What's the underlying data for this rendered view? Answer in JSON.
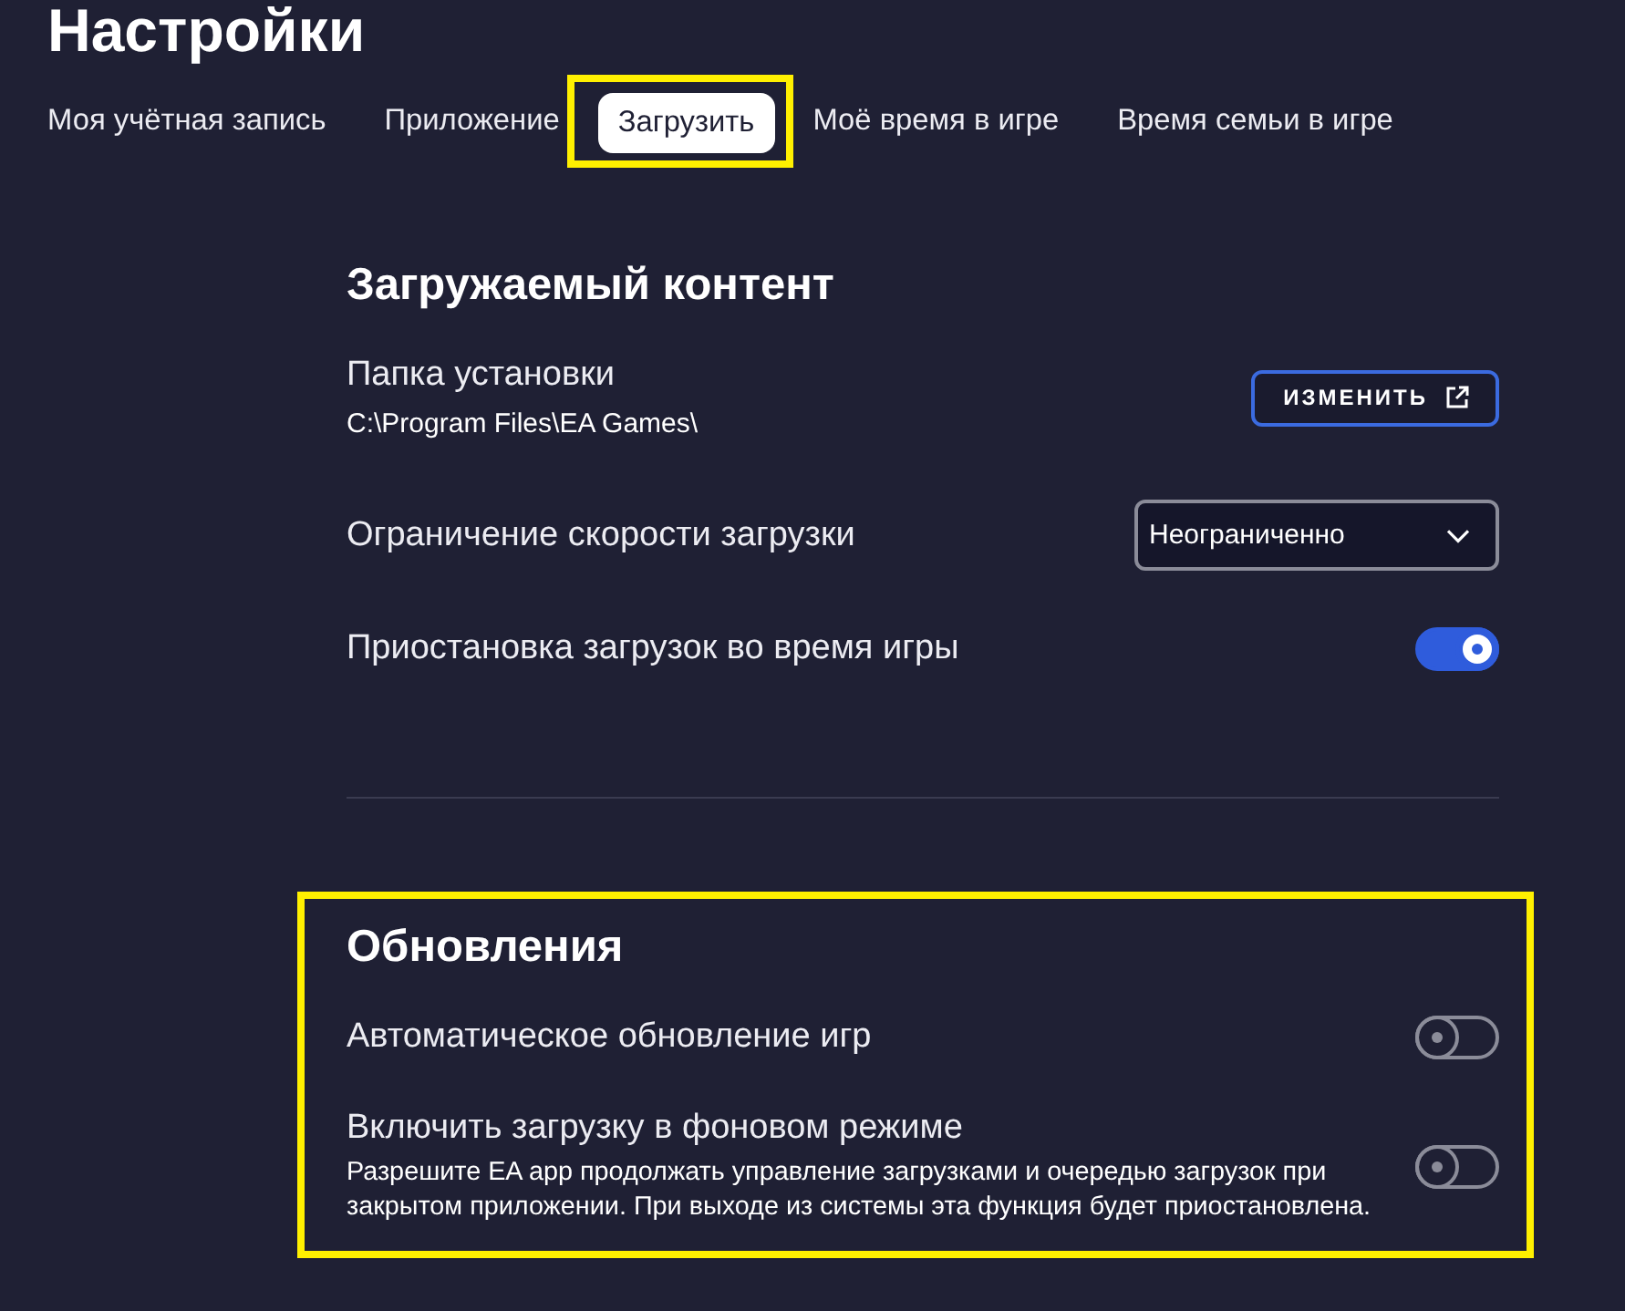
{
  "title": "Настройки",
  "tabs": [
    {
      "label": "Моя учётная запись",
      "selected": false,
      "highlighted": false
    },
    {
      "label": "Приложение",
      "selected": false,
      "highlighted": false
    },
    {
      "label": "Загрузить",
      "selected": true,
      "highlighted": true
    },
    {
      "label": "Моё время в игре",
      "selected": false,
      "highlighted": false
    },
    {
      "label": "Время семьи в игре",
      "selected": false,
      "highlighted": false
    }
  ],
  "sections": [
    {
      "title": "Загружаемый контент",
      "highlighted": false,
      "rows": [
        {
          "kind": "folder",
          "label": "Папка установки",
          "value": "C:\\Program Files\\EA Games\\",
          "button": "ИЗМЕНИТЬ"
        },
        {
          "kind": "dropdown",
          "label": "Ограничение скорости загрузки",
          "value": "Неограниченно"
        },
        {
          "kind": "toggle",
          "label": "Приостановка загрузок во время игры",
          "on": true
        }
      ]
    },
    {
      "title": "Обновления",
      "highlighted": true,
      "rows": [
        {
          "kind": "toggle",
          "label": "Автоматическое обновление игр",
          "on": false
        },
        {
          "kind": "toggle",
          "label": "Включить загрузку в фоновом режиме",
          "description": "Разрешите EA app продолжать управление загрузками и очередью загрузок при закрытом приложении. При выходе из системы эта функция будет приостановлена.",
          "on": false
        }
      ]
    }
  ]
}
